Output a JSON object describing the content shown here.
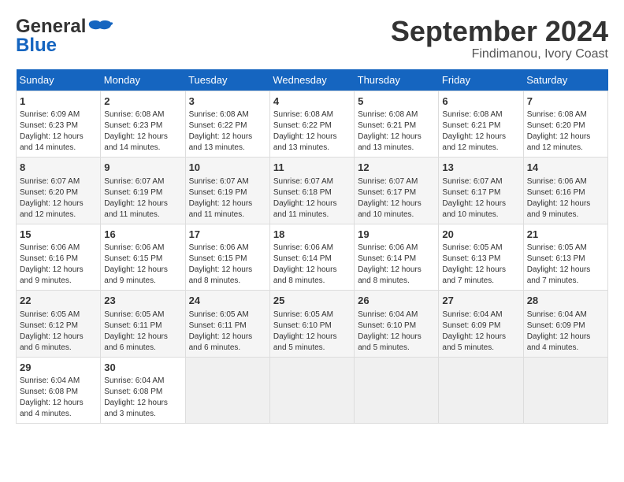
{
  "header": {
    "logo_general": "General",
    "logo_blue": "Blue",
    "month": "September 2024",
    "location": "Findimanou, Ivory Coast"
  },
  "days_of_week": [
    "Sunday",
    "Monday",
    "Tuesday",
    "Wednesday",
    "Thursday",
    "Friday",
    "Saturday"
  ],
  "weeks": [
    [
      {
        "day": "1",
        "info": "Sunrise: 6:09 AM\nSunset: 6:23 PM\nDaylight: 12 hours\nand 14 minutes."
      },
      {
        "day": "2",
        "info": "Sunrise: 6:08 AM\nSunset: 6:23 PM\nDaylight: 12 hours\nand 14 minutes."
      },
      {
        "day": "3",
        "info": "Sunrise: 6:08 AM\nSunset: 6:22 PM\nDaylight: 12 hours\nand 13 minutes."
      },
      {
        "day": "4",
        "info": "Sunrise: 6:08 AM\nSunset: 6:22 PM\nDaylight: 12 hours\nand 13 minutes."
      },
      {
        "day": "5",
        "info": "Sunrise: 6:08 AM\nSunset: 6:21 PM\nDaylight: 12 hours\nand 13 minutes."
      },
      {
        "day": "6",
        "info": "Sunrise: 6:08 AM\nSunset: 6:21 PM\nDaylight: 12 hours\nand 12 minutes."
      },
      {
        "day": "7",
        "info": "Sunrise: 6:08 AM\nSunset: 6:20 PM\nDaylight: 12 hours\nand 12 minutes."
      }
    ],
    [
      {
        "day": "8",
        "info": "Sunrise: 6:07 AM\nSunset: 6:20 PM\nDaylight: 12 hours\nand 12 minutes."
      },
      {
        "day": "9",
        "info": "Sunrise: 6:07 AM\nSunset: 6:19 PM\nDaylight: 12 hours\nand 11 minutes."
      },
      {
        "day": "10",
        "info": "Sunrise: 6:07 AM\nSunset: 6:19 PM\nDaylight: 12 hours\nand 11 minutes."
      },
      {
        "day": "11",
        "info": "Sunrise: 6:07 AM\nSunset: 6:18 PM\nDaylight: 12 hours\nand 11 minutes."
      },
      {
        "day": "12",
        "info": "Sunrise: 6:07 AM\nSunset: 6:17 PM\nDaylight: 12 hours\nand 10 minutes."
      },
      {
        "day": "13",
        "info": "Sunrise: 6:07 AM\nSunset: 6:17 PM\nDaylight: 12 hours\nand 10 minutes."
      },
      {
        "day": "14",
        "info": "Sunrise: 6:06 AM\nSunset: 6:16 PM\nDaylight: 12 hours\nand 9 minutes."
      }
    ],
    [
      {
        "day": "15",
        "info": "Sunrise: 6:06 AM\nSunset: 6:16 PM\nDaylight: 12 hours\nand 9 minutes."
      },
      {
        "day": "16",
        "info": "Sunrise: 6:06 AM\nSunset: 6:15 PM\nDaylight: 12 hours\nand 9 minutes."
      },
      {
        "day": "17",
        "info": "Sunrise: 6:06 AM\nSunset: 6:15 PM\nDaylight: 12 hours\nand 8 minutes."
      },
      {
        "day": "18",
        "info": "Sunrise: 6:06 AM\nSunset: 6:14 PM\nDaylight: 12 hours\nand 8 minutes."
      },
      {
        "day": "19",
        "info": "Sunrise: 6:06 AM\nSunset: 6:14 PM\nDaylight: 12 hours\nand 8 minutes."
      },
      {
        "day": "20",
        "info": "Sunrise: 6:05 AM\nSunset: 6:13 PM\nDaylight: 12 hours\nand 7 minutes."
      },
      {
        "day": "21",
        "info": "Sunrise: 6:05 AM\nSunset: 6:13 PM\nDaylight: 12 hours\nand 7 minutes."
      }
    ],
    [
      {
        "day": "22",
        "info": "Sunrise: 6:05 AM\nSunset: 6:12 PM\nDaylight: 12 hours\nand 6 minutes."
      },
      {
        "day": "23",
        "info": "Sunrise: 6:05 AM\nSunset: 6:11 PM\nDaylight: 12 hours\nand 6 minutes."
      },
      {
        "day": "24",
        "info": "Sunrise: 6:05 AM\nSunset: 6:11 PM\nDaylight: 12 hours\nand 6 minutes."
      },
      {
        "day": "25",
        "info": "Sunrise: 6:05 AM\nSunset: 6:10 PM\nDaylight: 12 hours\nand 5 minutes."
      },
      {
        "day": "26",
        "info": "Sunrise: 6:04 AM\nSunset: 6:10 PM\nDaylight: 12 hours\nand 5 minutes."
      },
      {
        "day": "27",
        "info": "Sunrise: 6:04 AM\nSunset: 6:09 PM\nDaylight: 12 hours\nand 5 minutes."
      },
      {
        "day": "28",
        "info": "Sunrise: 6:04 AM\nSunset: 6:09 PM\nDaylight: 12 hours\nand 4 minutes."
      }
    ],
    [
      {
        "day": "29",
        "info": "Sunrise: 6:04 AM\nSunset: 6:08 PM\nDaylight: 12 hours\nand 4 minutes."
      },
      {
        "day": "30",
        "info": "Sunrise: 6:04 AM\nSunset: 6:08 PM\nDaylight: 12 hours\nand 3 minutes."
      },
      {
        "day": "",
        "info": ""
      },
      {
        "day": "",
        "info": ""
      },
      {
        "day": "",
        "info": ""
      },
      {
        "day": "",
        "info": ""
      },
      {
        "day": "",
        "info": ""
      }
    ]
  ]
}
